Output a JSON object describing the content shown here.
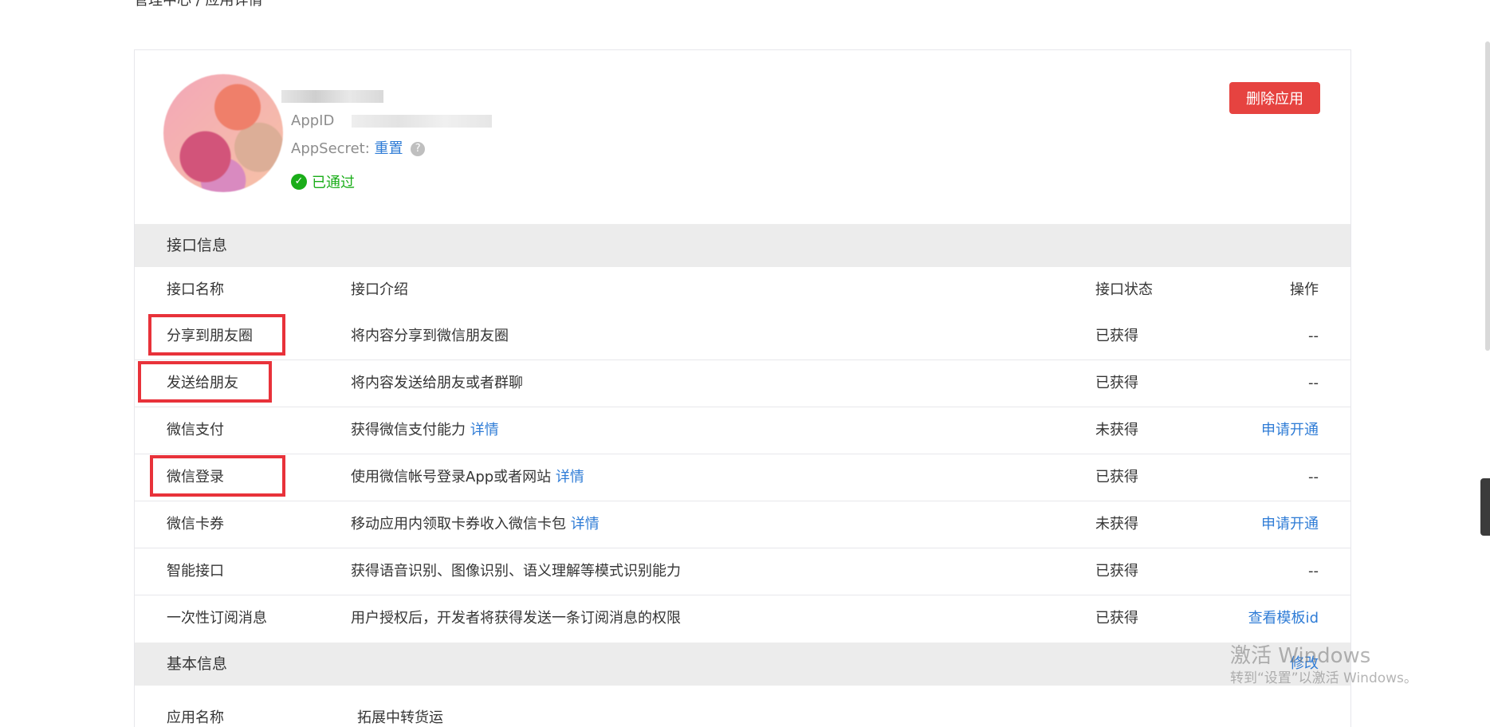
{
  "breadcrumb": "管理中心 / 应用详情",
  "app": {
    "appid_label": "AppID",
    "appsecret_label": "AppSecret:",
    "reset_link": "重置",
    "help_glyph": "?",
    "status": "已通过",
    "check_glyph": "✓",
    "delete_button": "删除应用"
  },
  "interface_section": {
    "title": "接口信息",
    "columns": {
      "name": "接口名称",
      "intro": "接口介绍",
      "state": "接口状态",
      "action": "操作"
    },
    "rows": [
      {
        "name": "分享到朋友圈",
        "intro": "将内容分享到微信朋友圈",
        "detail": "",
        "state": "已获得",
        "action": "--"
      },
      {
        "name": "发送给朋友",
        "intro": "将内容发送给朋友或者群聊",
        "detail": "",
        "state": "已获得",
        "action": "--"
      },
      {
        "name": "微信支付",
        "intro": "获得微信支付能力",
        "detail": "详情",
        "state": "未获得",
        "action": "申请开通"
      },
      {
        "name": "微信登录",
        "intro": "使用微信帐号登录App或者网站",
        "detail": "详情",
        "state": "已获得",
        "action": "--"
      },
      {
        "name": "微信卡券",
        "intro": "移动应用内领取卡券收入微信卡包",
        "detail": "详情",
        "state": "未获得",
        "action": "申请开通"
      },
      {
        "name": "智能接口",
        "intro": "获得语音识别、图像识别、语义理解等模式识别能力",
        "detail": "",
        "state": "已获得",
        "action": "--"
      },
      {
        "name": "一次性订阅消息",
        "intro": "用户授权后，开发者将获得发送一条订阅消息的权限",
        "detail": "",
        "state": "已获得",
        "action": "查看模板id"
      }
    ]
  },
  "basic_section": {
    "title": "基本信息",
    "edit_link": "修改",
    "app_name_label": "应用名称",
    "app_name_value": "拓展中转货运"
  },
  "watermark": {
    "title": "激活 Windows",
    "subtitle": "转到“设置”以激活 Windows。"
  },
  "colors": {
    "accent_link": "#2f7cd6",
    "danger": "#e64340",
    "success": "#1aad19",
    "highlight": "#e8323a"
  }
}
